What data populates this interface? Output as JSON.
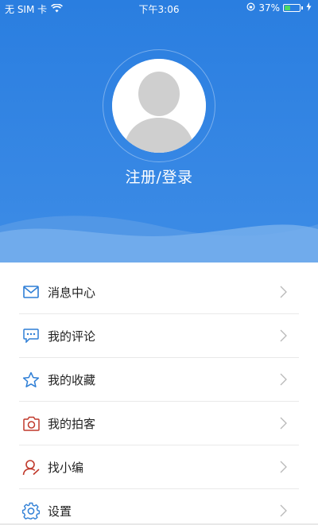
{
  "status_bar": {
    "carrier": "无 SIM 卡",
    "time": "下午3:06",
    "battery_percent_text": "37%",
    "battery_level": 0.37
  },
  "profile": {
    "login_text": "注册/登录"
  },
  "menu": {
    "items": [
      {
        "label": "消息中心",
        "icon": "mail-icon"
      },
      {
        "label": "我的评论",
        "icon": "comment-icon"
      },
      {
        "label": "我的收藏",
        "icon": "star-icon"
      },
      {
        "label": "我的拍客",
        "icon": "camera-icon"
      },
      {
        "label": "找小编",
        "icon": "user-icon"
      },
      {
        "label": "设置",
        "icon": "gear-icon"
      }
    ]
  },
  "colors": {
    "header_blue": "#2a7ee0",
    "icon_blue": "#2f7fd6",
    "icon_red": "#c0392b",
    "chevron_gray": "#b8b8b8"
  }
}
